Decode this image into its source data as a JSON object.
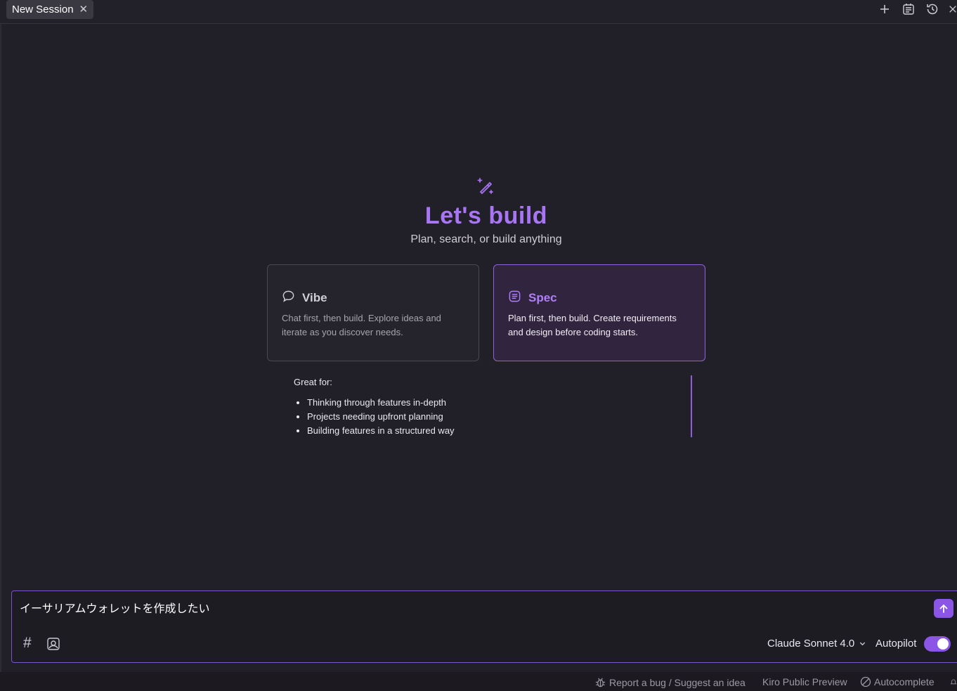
{
  "tab": {
    "title": "New Session",
    "close_glyph": "✕"
  },
  "tab_actions": [
    "plus-icon",
    "session-list-icon",
    "history-icon",
    "close-icon"
  ],
  "hero": {
    "icon": "magic-wand-icon",
    "title": "Let's build",
    "subtitle": "Plan, search, or build anything"
  },
  "modes": {
    "vibe": {
      "icon": "chat-bubble-icon",
      "title": "Vibe",
      "description": "Chat first, then build. Explore ideas and iterate as you discover needs."
    },
    "spec": {
      "icon": "document-icon",
      "title": "Spec",
      "description": "Plan first, then build. Create requirements and design before coding starts.",
      "selected": true
    }
  },
  "great_for": {
    "label": "Great for:",
    "items": [
      "Thinking through features in-depth",
      "Projects needing upfront planning",
      "Building features in a structured way"
    ]
  },
  "composer": {
    "text": "イーサリアムウォレットを作成したい",
    "hash_glyph": "#",
    "model": "Claude Sonnet 4.0",
    "autopilot_label": "Autopilot",
    "autopilot_on": true
  },
  "status": {
    "bug": "Report a bug / Suggest an idea",
    "preview": "Kiro Public Preview",
    "autocomplete": "Autocomplete"
  },
  "colors": {
    "accent": "#a876f5",
    "background": "#211f27",
    "spec_card_bg": "#31243f",
    "button_purple": "#8b55e6"
  }
}
